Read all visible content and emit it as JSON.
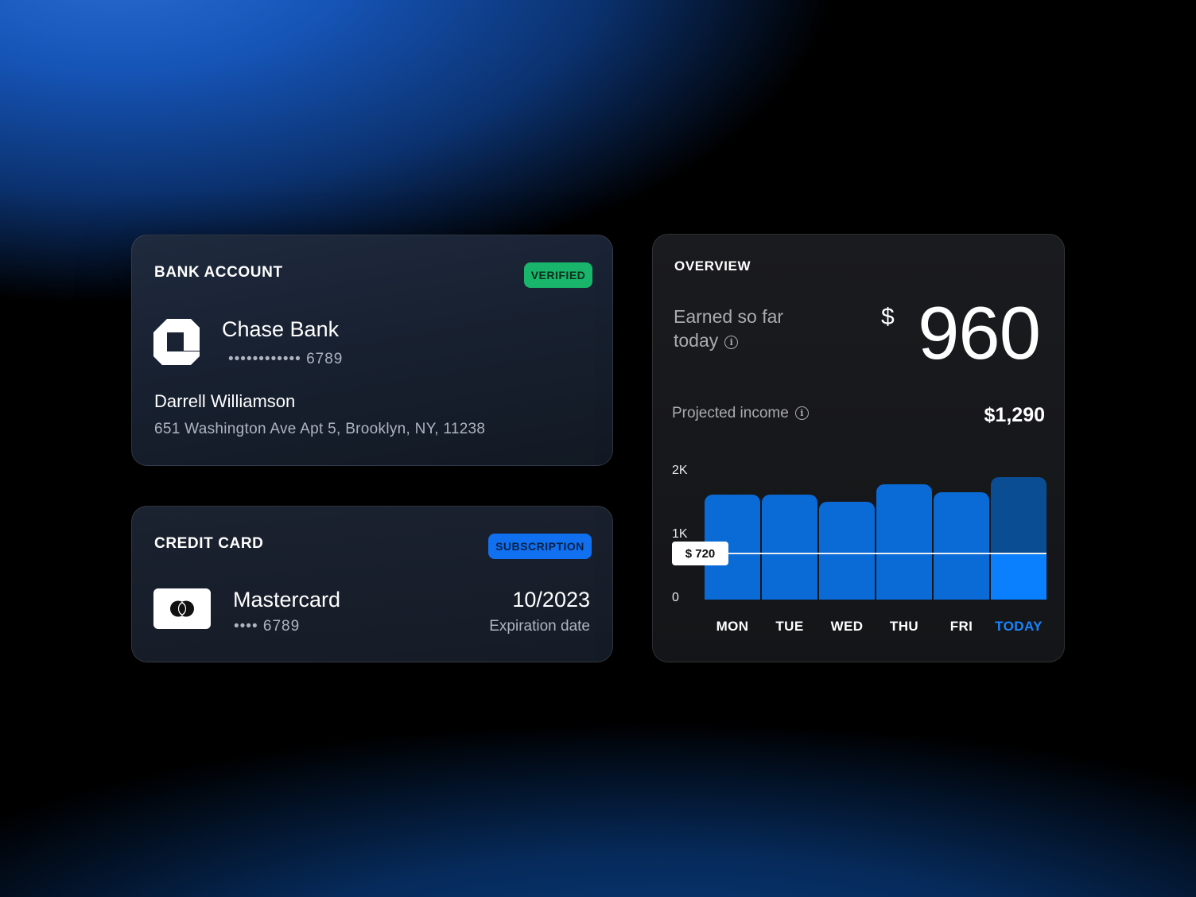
{
  "bank_account": {
    "title": "BANK ACCOUNT",
    "status_badge": "VERIFIED",
    "bank_name": "Chase Bank",
    "account_masked": "••••••••••••  6789",
    "holder_name": "Darrell Williamson",
    "address": "651 Washington Ave Apt 5, Brooklyn, NY, 11238",
    "logo_icon": "chase-octagon-icon"
  },
  "credit_card": {
    "title": "CREDIT CARD",
    "badge": "SUBSCRIPTION",
    "card_name": "Mastercard",
    "card_masked": "••••  6789",
    "expiration": "10/2023",
    "expiration_label": "Expiration date",
    "logo_icon": "mastercard-icon"
  },
  "overview": {
    "title": "OVERVIEW",
    "earned_label_line1": "Earned so far",
    "earned_label_line2": "today",
    "earned_currency": "$",
    "earned_value": "960",
    "projected_label": "Projected income",
    "projected_value": "$1,290",
    "marker_label": "$ 720"
  },
  "colors": {
    "verified": "#19b56b",
    "subscription": "#1170f0",
    "bar": "#0a6ad6",
    "bar_today_upper": "#0b4d92",
    "bar_today_lower": "#0a80ff",
    "today_label": "#1a84ff"
  },
  "chart_data": {
    "type": "bar",
    "categories": [
      "MON",
      "TUE",
      "WED",
      "THU",
      "FRI",
      "TODAY"
    ],
    "values": [
      1650,
      1650,
      1540,
      1810,
      1690,
      1920
    ],
    "y_ticks": [
      "0",
      "1K",
      "2K"
    ],
    "ylim": [
      0,
      2000
    ],
    "reference_line": 720,
    "reference_label": "$ 720",
    "grid": false
  }
}
